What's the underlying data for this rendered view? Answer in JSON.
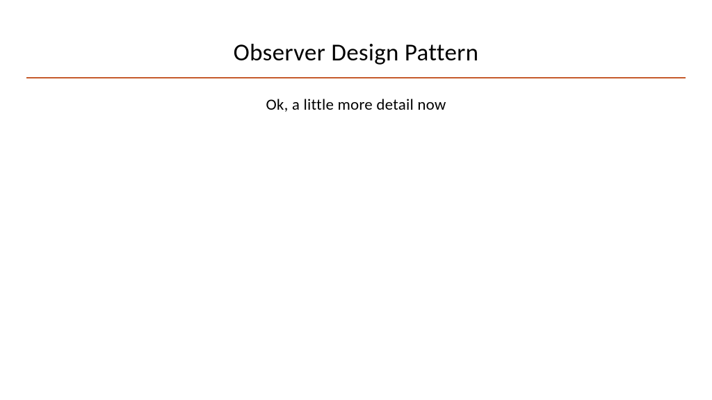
{
  "slide": {
    "title": "Observer Design Pattern",
    "subtitle": "Ok, a little more detail now"
  }
}
